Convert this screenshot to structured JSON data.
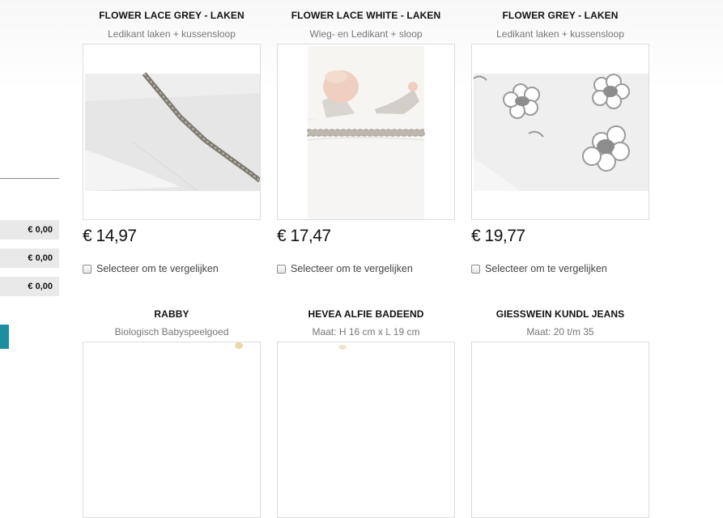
{
  "sidebar": {
    "prices": [
      "€ 0,00",
      "€ 0,00",
      "€ 0,00"
    ]
  },
  "products": [
    {
      "title": "FLOWER LACE GREY - LAKEN",
      "subtitle": "Ledikant laken + kussensloop",
      "price": "€ 14,97",
      "compare": "Selecteer om te vergelijken",
      "image": "grey-lace-sheet"
    },
    {
      "title": "FLOWER LACE WHITE - LAKEN",
      "subtitle": "Wieg- en Ledikant + sloop",
      "price": "€ 17,47",
      "compare": "Selecteer om te vergelijken",
      "image": "sleeping-baby"
    },
    {
      "title": "FLOWER GREY - LAKEN",
      "subtitle": "Ledikant laken + kussensloop",
      "price": "€ 19,77",
      "compare": "Selecteer om te vergelijken",
      "image": "grey-flower-sheet"
    },
    {
      "title": "RABBY",
      "subtitle": "Biologisch Babyspeelgoed"
    },
    {
      "title": "HEVEA ALFIE BADEEND",
      "subtitle": "Maat: H 16 cm x L 19 cm"
    },
    {
      "title": "GIESSWEIN KUNDL JEANS",
      "subtitle": "Maat: 20 t/m 35"
    }
  ],
  "colors": {
    "accent": "#1b8fa0",
    "price_box": "#e9e9e9"
  }
}
